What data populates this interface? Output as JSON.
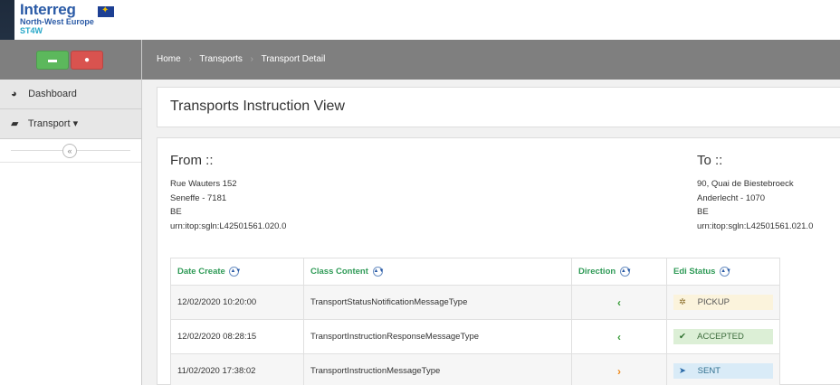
{
  "logo": {
    "line1": "Interreg",
    "line2": "North-West Europe",
    "line3": "ST4W"
  },
  "sidebar": {
    "items": [
      {
        "label": "Dashboard",
        "icon": "tachometer-icon"
      },
      {
        "label": "Transport",
        "icon": "truck-icon",
        "caret": "▾"
      }
    ],
    "collapse_glyph": "«",
    "top_buttons": [
      {
        "icon": "truck-icon",
        "color": "#5cb85c"
      },
      {
        "icon": "user-icon",
        "color": "#d9534f"
      }
    ]
  },
  "breadcrumb": [
    "Home",
    "Transports",
    "Transport Detail"
  ],
  "page": {
    "title": "Transports Instruction View"
  },
  "from": {
    "heading": "From ::",
    "street": "Rue Wauters 152",
    "city": "Seneffe - 7181",
    "country": "BE",
    "urn": "urn:itop:sgln:L42501561.020.0"
  },
  "to": {
    "heading": "To ::",
    "street": "90, Quai de Biestebroeck",
    "city": "Anderlecht - 1070",
    "country": "BE",
    "urn": "urn:itop:sgln:L42501561.021.0"
  },
  "table": {
    "headers": [
      "Date Create",
      "Class Content",
      "Direction",
      "Edi Status"
    ],
    "rows": [
      {
        "date": "12/02/2020 10:20:00",
        "class": "TransportStatusNotificationMessageType",
        "direction": "‹",
        "status": "PICKUP"
      },
      {
        "date": "12/02/2020 08:28:15",
        "class": "TransportInstructionResponseMessageType",
        "direction": "‹",
        "status": "ACCEPTED"
      },
      {
        "date": "11/02/2020 17:38:02",
        "class": "TransportInstructionMessageType",
        "direction": "›",
        "status": "SENT"
      }
    ]
  },
  "colors": {
    "header_green": "#2e9a56",
    "topbar_gray": "#7f7f7f",
    "inbound": "#3a9d3a",
    "outbound": "#ef8a1e"
  }
}
